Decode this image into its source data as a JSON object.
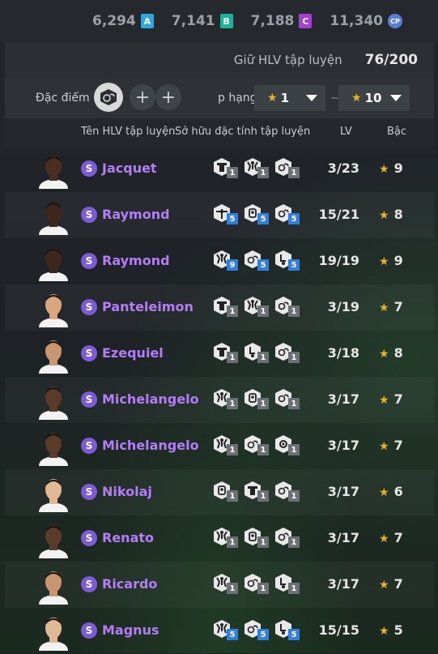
{
  "currency": [
    {
      "value": "6,294",
      "badge": "A",
      "color": "#2ea7e0"
    },
    {
      "value": "7,141",
      "badge": "B",
      "color": "#19b39a"
    },
    {
      "value": "7,188",
      "badge": "C",
      "color": "#a63ed6"
    },
    {
      "value": "11,340",
      "badge": "CP",
      "color": "#5b7fd6"
    }
  ],
  "keep": {
    "label": "Giữ HLV tập luyện",
    "value": "76/200"
  },
  "filter": {
    "trait_label": "Đặc điểm c",
    "rank_label": "p hạng",
    "rank_min": "1",
    "rank_max": "10",
    "range_sep": "~"
  },
  "table": {
    "headers": {
      "name": "Tên HLV tập luyện",
      "traits": "Sở hữu đặc tính tập luyện",
      "lv": "LV",
      "grade": "Bậc"
    },
    "rows": [
      {
        "name": "Jacquet",
        "traits": [
          {
            "icon": "shield-trait-icon",
            "lv": "1"
          },
          {
            "icon": "player-trait-icon",
            "lv": "1"
          },
          {
            "icon": "ball-trait-icon",
            "lv": "1"
          }
        ],
        "lv": "3/23",
        "grade": "9",
        "skin": "#4a2e20"
      },
      {
        "name": "Raymond",
        "traits": [
          {
            "icon": "target-trait-icon",
            "lv": "5"
          },
          {
            "icon": "badge-trait-icon",
            "lv": "5"
          },
          {
            "icon": "ball-trait-icon",
            "lv": "5"
          }
        ],
        "lv": "15/21",
        "grade": "8",
        "skin": "#3d271c"
      },
      {
        "name": "Raymond",
        "traits": [
          {
            "icon": "player-trait-icon",
            "lv": "9"
          },
          {
            "icon": "ball-trait-icon",
            "lv": "5"
          },
          {
            "icon": "kick-trait-icon",
            "lv": "5"
          }
        ],
        "lv": "19/19",
        "grade": "9",
        "skin": "#3d271c"
      },
      {
        "name": "Panteleimon",
        "traits": [
          {
            "icon": "shield-trait-icon",
            "lv": "1"
          },
          {
            "icon": "player-trait-icon",
            "lv": "1"
          },
          {
            "icon": "ball-trait-icon",
            "lv": "1"
          }
        ],
        "lv": "3/19",
        "grade": "7",
        "skin": "#d9a67e"
      },
      {
        "name": "Ezequiel",
        "traits": [
          {
            "icon": "shield-trait-icon",
            "lv": "1"
          },
          {
            "icon": "kick-trait-icon",
            "lv": "1"
          },
          {
            "icon": "ball-trait-icon",
            "lv": "1"
          }
        ],
        "lv": "3/18",
        "grade": "8",
        "skin": "#c99670"
      },
      {
        "name": "Michelangelo",
        "traits": [
          {
            "icon": "player-trait-icon",
            "lv": "1"
          },
          {
            "icon": "badge-trait-icon",
            "lv": "1"
          },
          {
            "icon": "ball-trait-icon",
            "lv": "1"
          }
        ],
        "lv": "3/17",
        "grade": "7",
        "skin": "#5a3a28"
      },
      {
        "name": "Michelangelo",
        "traits": [
          {
            "icon": "player-trait-icon",
            "lv": "1"
          },
          {
            "icon": "ball-trait-icon",
            "lv": "1"
          },
          {
            "icon": "gear-trait-icon",
            "lv": "1"
          }
        ],
        "lv": "3/17",
        "grade": "7",
        "skin": "#5a3a28"
      },
      {
        "name": "Nikolaj",
        "traits": [
          {
            "icon": "badge-trait-icon",
            "lv": "1"
          },
          {
            "icon": "shield-trait-icon",
            "lv": "1"
          },
          {
            "icon": "ball-trait-icon",
            "lv": "1"
          }
        ],
        "lv": "3/17",
        "grade": "6",
        "skin": "#e0b894"
      },
      {
        "name": "Renato",
        "traits": [
          {
            "icon": "player-trait-icon",
            "lv": "1"
          },
          {
            "icon": "badge-trait-icon",
            "lv": "1"
          },
          {
            "icon": "ball-trait-icon",
            "lv": "1"
          }
        ],
        "lv": "3/17",
        "grade": "7",
        "skin": "#5a3a28"
      },
      {
        "name": "Ricardo",
        "traits": [
          {
            "icon": "player-trait-icon",
            "lv": "1"
          },
          {
            "icon": "ball-trait-icon",
            "lv": "1"
          },
          {
            "icon": "kick-trait-icon",
            "lv": "1"
          }
        ],
        "lv": "3/17",
        "grade": "7",
        "skin": "#c99670"
      },
      {
        "name": "Magnus",
        "traits": [
          {
            "icon": "player-trait-icon",
            "lv": "5"
          },
          {
            "icon": "ball-trait-icon",
            "lv": "5"
          },
          {
            "icon": "kick-trait-icon",
            "lv": "5"
          }
        ],
        "lv": "15/15",
        "grade": "5",
        "skin": "#e0b894"
      }
    ]
  }
}
